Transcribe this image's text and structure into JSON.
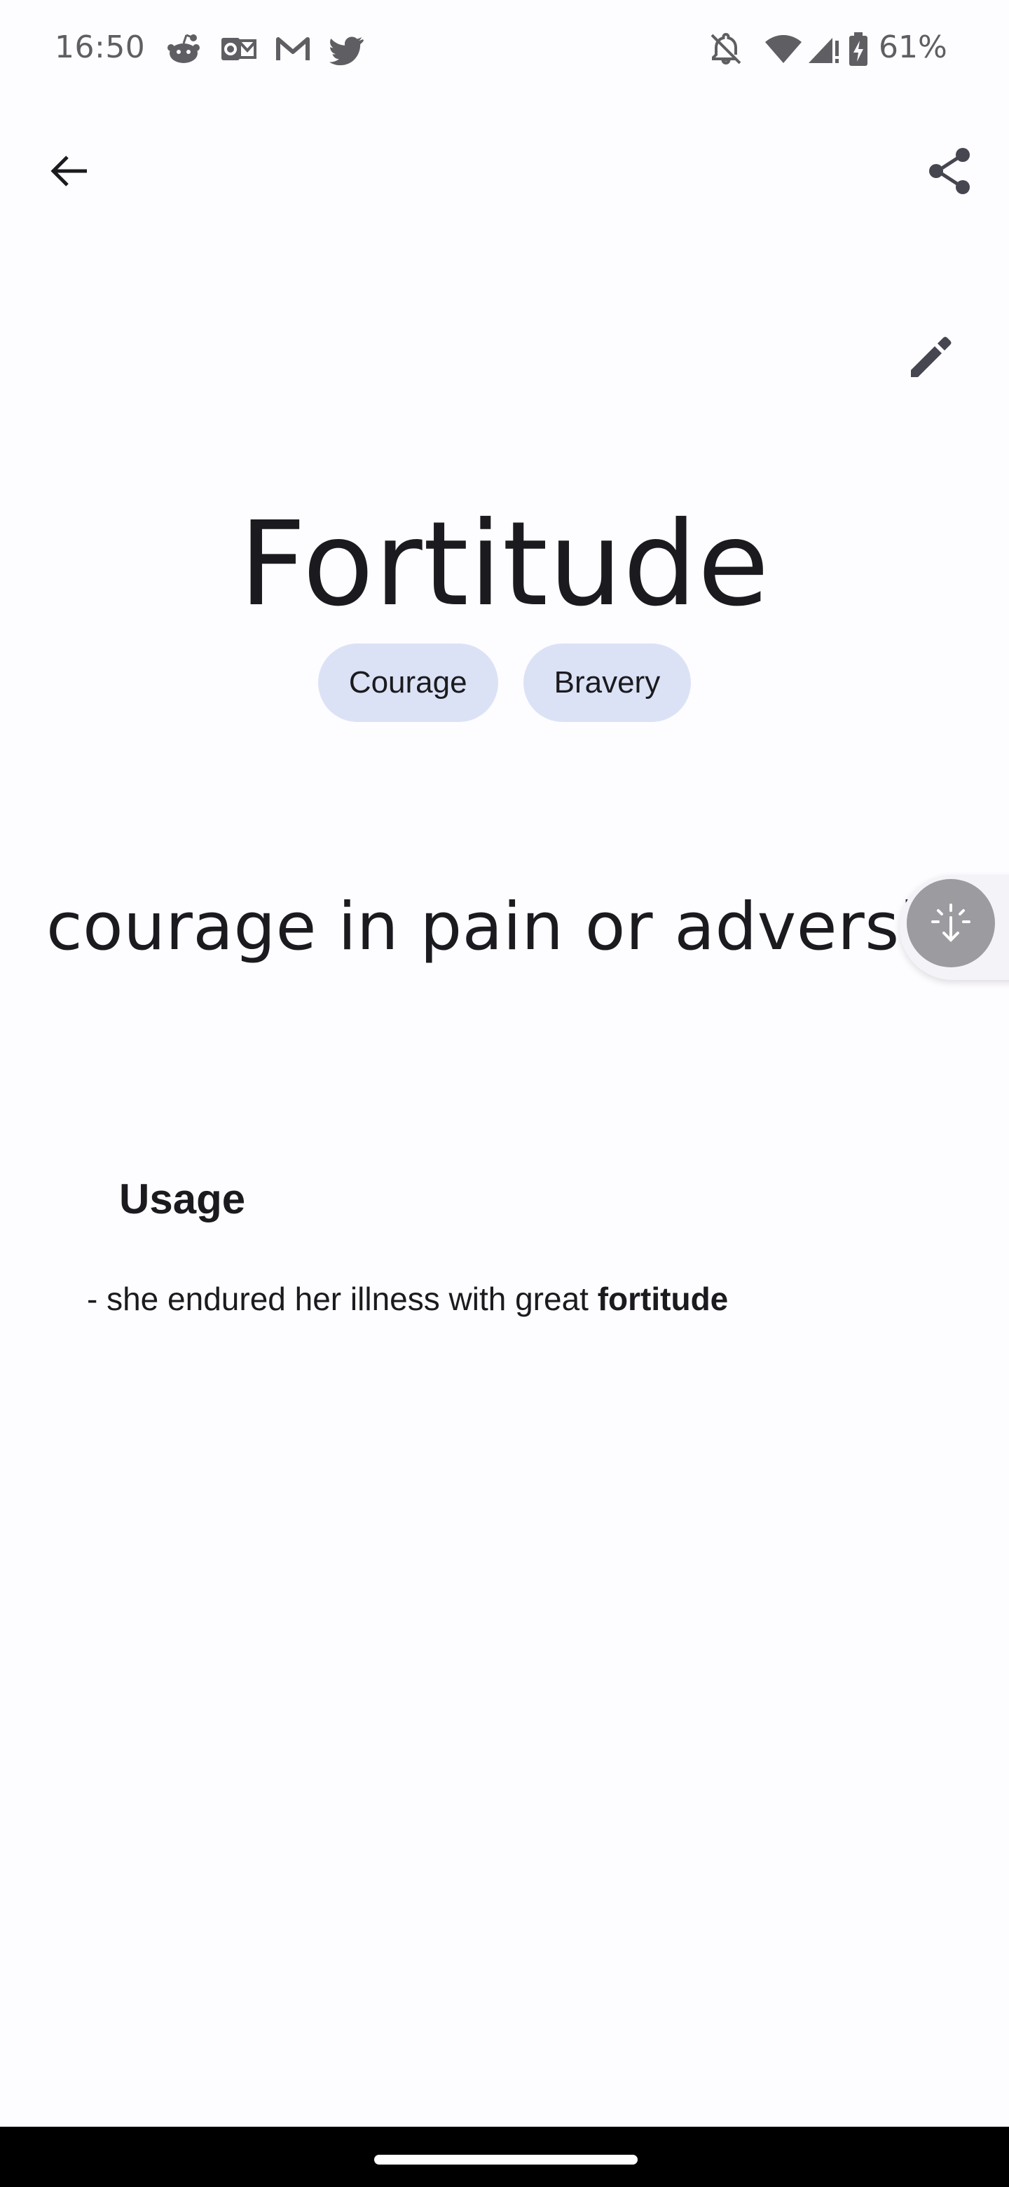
{
  "status_bar": {
    "time": "16:50",
    "notification_icons": [
      "reddit-icon",
      "outlook-icon",
      "gmail-icon",
      "twitter-icon"
    ],
    "system_icons": [
      "notifications-off-icon",
      "wifi-icon",
      "signal-icon",
      "battery-charging-icon"
    ],
    "battery": "61%"
  },
  "app_bar": {
    "back_icon": "arrow-back-icon",
    "share_icon": "share-icon",
    "edit_icon": "edit-pencil-icon"
  },
  "word": {
    "title": "Fortitude",
    "synonyms": [
      "Courage",
      "Bravery"
    ]
  },
  "definition": {
    "text": "courage in pain or adversity."
  },
  "usage": {
    "heading": "Usage",
    "prefix": "- she endured her illness with great ",
    "highlight": "fortitude"
  },
  "colors": {
    "background": "#fdfcff",
    "chip_background": "#dce2f6",
    "text": "#1b1b1f",
    "status_text": "#5f5f63"
  }
}
